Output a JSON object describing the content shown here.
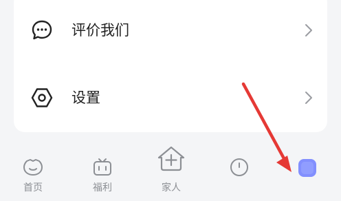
{
  "menu": {
    "items": [
      {
        "label": "评价我们",
        "icon": "chat-bubble-icon"
      },
      {
        "label": "设置",
        "icon": "hexagon-settings-icon"
      }
    ]
  },
  "tabbar": {
    "tabs": [
      {
        "label": "首页",
        "icon": "home-face-icon"
      },
      {
        "label": "福利",
        "icon": "gift-bag-icon"
      },
      {
        "label": "家人",
        "icon": "house-plus-icon"
      },
      {
        "label": "",
        "icon": "circle-icon"
      },
      {
        "label": "",
        "icon": "avatar-icon"
      }
    ]
  },
  "colors": {
    "background": "#f4f5f7",
    "card": "#ffffff",
    "text": "#222222",
    "tab_text": "#8c8f94",
    "annotation_arrow": "#e53935",
    "profile_tab_accent": "#6d7cff"
  }
}
